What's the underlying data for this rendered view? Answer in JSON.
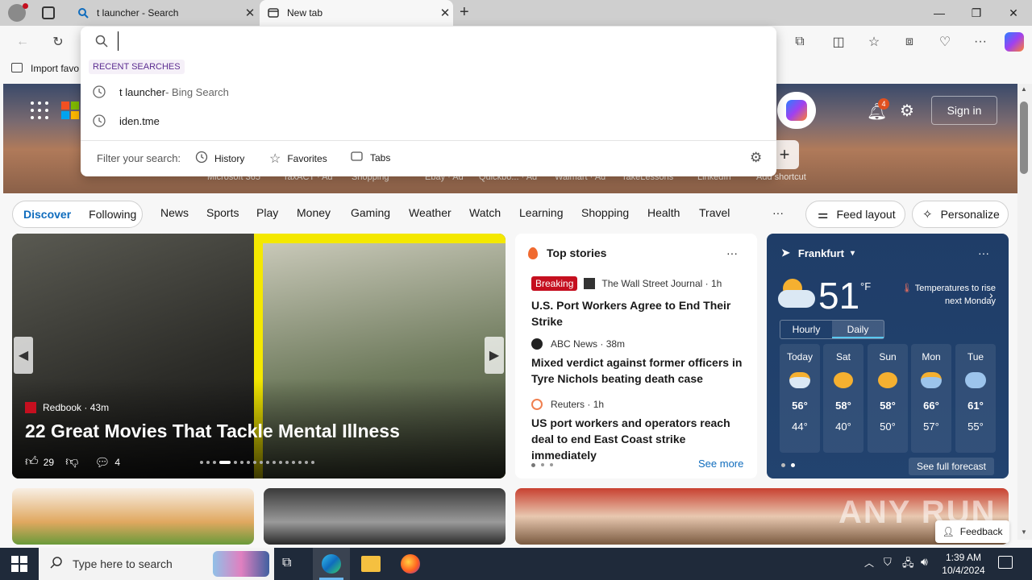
{
  "tabs": [
    {
      "label": "t launcher - Search"
    },
    {
      "label": "New tab"
    }
  ],
  "favbar": {
    "import_label": "Import favo"
  },
  "dropdown": {
    "input_value": "",
    "recent_heading": "RECENT SEARCHES",
    "items": [
      {
        "text": "t launcher",
        "suffix": " - Bing Search"
      },
      {
        "text": "iden.tme",
        "suffix": ""
      }
    ],
    "filter_label": "Filter your search:",
    "filters": [
      "History",
      "Favorites",
      "Tabs"
    ]
  },
  "hero": {
    "signin_label": "Sign in",
    "notif_count": "4",
    "shortcuts": [
      "Microsoft 365",
      "TaxACT · Ad",
      "Shopping",
      "Ebay · Ad",
      "Quickbo... · Ad",
      "Walmart · Ad",
      "TakeLessons",
      "LinkedIn",
      "Add shortcut"
    ]
  },
  "feednav": {
    "discover": "Discover",
    "following": "Following",
    "links": [
      "News",
      "Sports",
      "Play",
      "Money",
      "Gaming",
      "Weather",
      "Watch",
      "Learning",
      "Shopping",
      "Health",
      "Travel"
    ],
    "more": "···",
    "feed_layout": "Feed layout",
    "personalize": "Personalize"
  },
  "main_story": {
    "source": "Redbook",
    "age": "· 43m",
    "title": "22 Great Movies That Tackle Mental Illness",
    "likes": "29",
    "comments": "4"
  },
  "top_stories": {
    "heading": "Top stories",
    "stories": [
      {
        "badge": "Breaking",
        "source": "The Wall Street Journal",
        "age": "· 1h",
        "title": "U.S. Port Workers Agree to End Their Strike"
      },
      {
        "badge": "",
        "source": "ABC News",
        "age": "· 38m",
        "title": "Mixed verdict against former officers in Tyre Nichols beating death case"
      },
      {
        "badge": "",
        "source": "Reuters",
        "age": "· 1h",
        "title": "US port workers and operators reach deal to end East Coast strike immediately"
      }
    ],
    "see_more": "See more"
  },
  "weather": {
    "location": "Frankfurt",
    "temp": "51",
    "unit": "°F",
    "note": "Temperatures to rise next Monday",
    "tabs": [
      "Hourly",
      "Daily"
    ],
    "days": [
      {
        "name": "Today",
        "hi": "56°",
        "lo": "44°"
      },
      {
        "name": "Sat",
        "hi": "58°",
        "lo": "40°"
      },
      {
        "name": "Sun",
        "hi": "58°",
        "lo": "50°"
      },
      {
        "name": "Mon",
        "hi": "66°",
        "lo": "57°"
      },
      {
        "name": "Tue",
        "hi": "61°",
        "lo": "55°"
      }
    ],
    "see_forecast": "See full forecast"
  },
  "feedback": "Feedback",
  "watermark": "ANY RUN",
  "taskbar": {
    "search_placeholder": "Type here to search",
    "time": "1:39 AM",
    "date": "10/4/2024"
  },
  "colors": {
    "accent": "#0f6cbd",
    "breaking": "#c50f1f",
    "weather_bg": "#1f3d68"
  }
}
